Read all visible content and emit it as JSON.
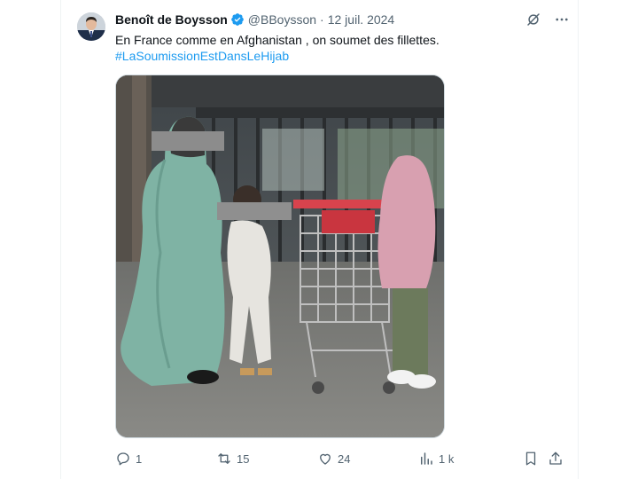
{
  "tweet": {
    "author_name": "Benoît de Boysson",
    "handle": "@BBoysson",
    "separator": "·",
    "date": "12 juil. 2024",
    "text": "En France comme en Afghanistan , on soumet des fillettes.",
    "hashtag": "#LaSoumissionEstDansLeHijab"
  },
  "actions": {
    "replies": "1",
    "reposts": "15",
    "likes": "24",
    "views": "1 k"
  },
  "colors": {
    "link": "#1d9bf0",
    "muted": "#536471",
    "text": "#0f1419",
    "verified": "#1d9bf0"
  }
}
